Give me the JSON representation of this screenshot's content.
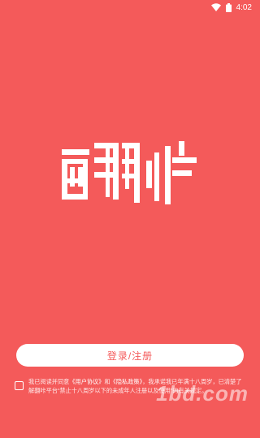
{
  "status_bar": {
    "time": "4:02",
    "wifi_icon": "wifi-icon",
    "battery_icon": "battery-icon"
  },
  "logo": {
    "text": "翻咔",
    "icon": "app-logo"
  },
  "login": {
    "button_label": "登录/注册"
  },
  "agreement": {
    "prefix": "我已阅读并同意",
    "user_agreement": "《用户协议》",
    "and": "和",
    "privacy_policy": "《隐私政策》",
    "suffix": "，我承诺我已年满十八周岁，已清楚了解翻咔平台“禁止十八周岁以下的未成年人注册以及使用”的有关规定。"
  },
  "watermark": {
    "text": "1bd.com"
  },
  "colors": {
    "background": "#F45A5A",
    "button_bg": "#FFFFFF",
    "button_text": "#F45A5A"
  }
}
